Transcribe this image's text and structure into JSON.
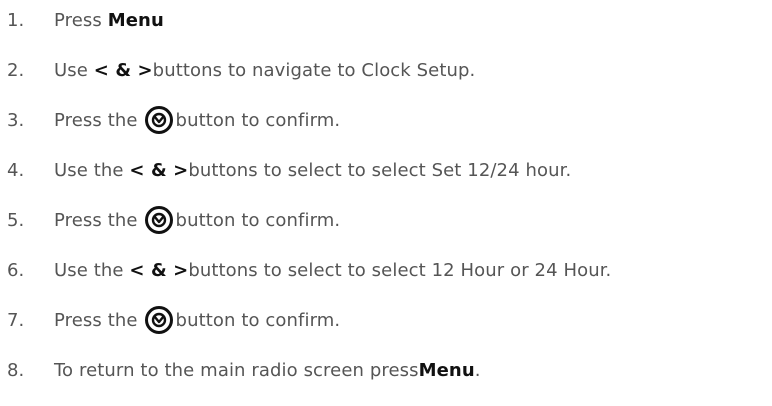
{
  "steps": [
    {
      "num": "1.",
      "pre": "Press ",
      "bold": "Menu",
      "post": ""
    },
    {
      "num": "2.",
      "pre": "Use ",
      "bold": "< & >",
      "post": " buttons to navigate to Clock Setup."
    },
    {
      "num": "3.",
      "pre": "Press the ",
      "icon": "confirm-button-icon",
      "post": "button to confirm."
    },
    {
      "num": "4.",
      "pre": "Use the ",
      "bold": "< & >",
      "post": " buttons to select to select Set 12/24 hour."
    },
    {
      "num": "5.",
      "pre": "Press the ",
      "icon": "confirm-button-icon",
      "post": "button to confirm."
    },
    {
      "num": "6.",
      "pre": "Use the ",
      "bold": "< & >",
      "post": " buttons to select to select 12 Hour or 24 Hour."
    },
    {
      "num": "7.",
      "pre": "Press the ",
      "icon": "confirm-button-icon",
      "post": "button to confirm."
    },
    {
      "num": "8.",
      "pre": "To return to the main radio screen press ",
      "bold": "Menu",
      "post": "."
    }
  ],
  "colors": {
    "text": "#555555",
    "bold": "#111111",
    "icon": "#111111"
  }
}
